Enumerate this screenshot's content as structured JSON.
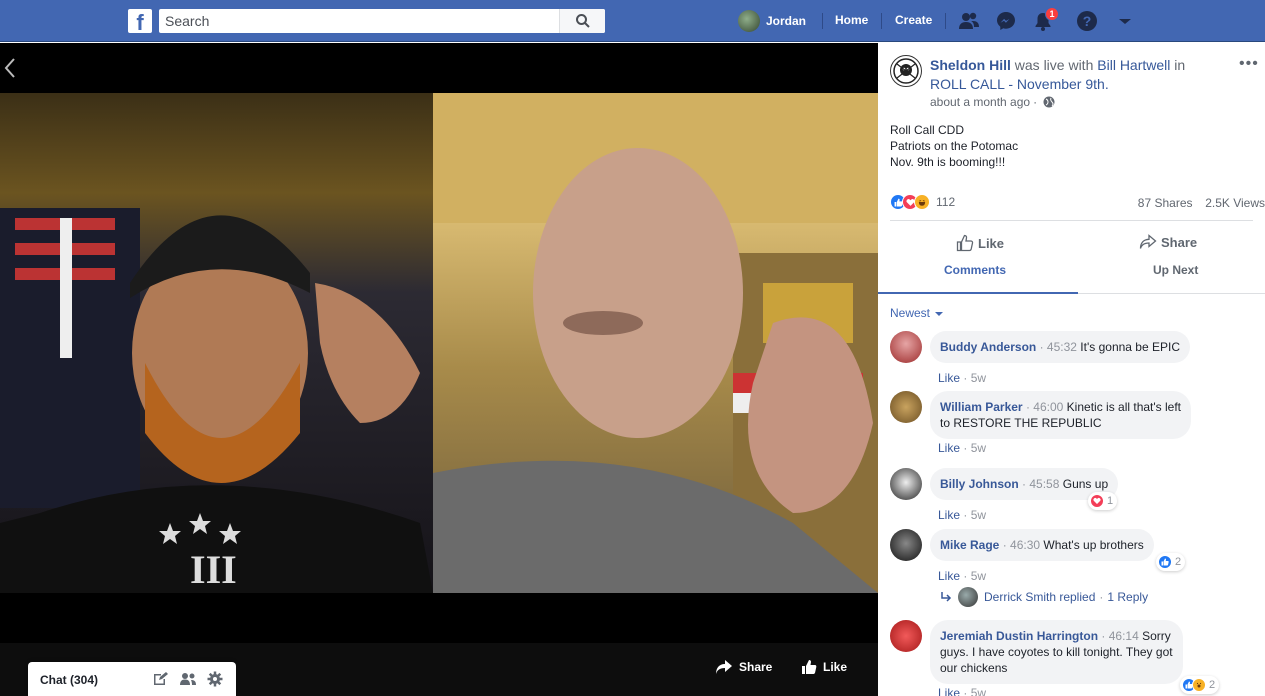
{
  "topbar": {
    "logo_letter": "f",
    "search_placeholder": "Search",
    "user_name": "Jordan",
    "home_label": "Home",
    "create_label": "Create",
    "notification_count": "1"
  },
  "video": {
    "share_label": "Share",
    "like_label": "Like"
  },
  "chat": {
    "label": "Chat (304)"
  },
  "post": {
    "author": "Sheldon Hill",
    "was_live_with": "was live with",
    "with_name": "Bill Hartwell",
    "in_text": "in",
    "event": "ROLL CALL - November 9th.",
    "time": "about a month ago",
    "text_lines": [
      "Roll Call CDD",
      "Patriots on the Potomac",
      "Nov. 9th is booming!!!"
    ],
    "reaction_count": "112",
    "shares": "87 Shares",
    "views": "2.5K Views",
    "like_action": "Like",
    "share_action": "Share",
    "tab_comments": "Comments",
    "tab_up_next": "Up Next",
    "sort_label": "Newest"
  },
  "comments": [
    {
      "name": "Buddy Anderson",
      "time": "45:32",
      "text": "It's gonna be EPIC",
      "like": "Like",
      "age": "5w",
      "reaction_count": ""
    },
    {
      "name": "William Parker",
      "time": "46:00",
      "text_line1": "Kinetic is all that's left",
      "text_line2": "to RESTORE THE REPUBLIC",
      "like": "Like",
      "age": "5w",
      "reaction_count": ""
    },
    {
      "name": "Billy Johnson",
      "time": "45:58",
      "text": "Guns up",
      "like": "Like",
      "age": "5w",
      "reaction_count": "1"
    },
    {
      "name": "Mike Rage",
      "time": "46:30",
      "text": "What's up brothers",
      "like": "Like",
      "age": "5w",
      "reaction_count": "2"
    },
    {
      "name": "Jeremiah Dustin Harrington",
      "time": "46:14",
      "text_line1_suffix": "Sorry",
      "text_line2": "guys. I have coyotes to kill tonight. They got",
      "text_line3": "our chickens",
      "like": "Like",
      "age": "5w",
      "reaction_count": "2"
    }
  ],
  "reply": {
    "text": "Derrick Smith replied",
    "dot": "·",
    "count": "1 Reply"
  },
  "colors": {
    "brand": "#4267b2",
    "link": "#385898",
    "muted": "#90949c"
  }
}
